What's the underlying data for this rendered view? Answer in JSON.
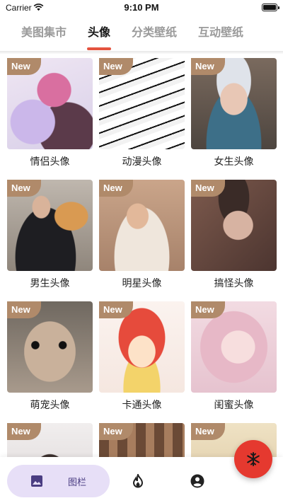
{
  "status": {
    "carrier": "Carrier",
    "time": "9:10 PM"
  },
  "tabs": [
    {
      "label": "美图集市",
      "active": false
    },
    {
      "label": "头像",
      "active": true
    },
    {
      "label": "分类壁纸",
      "active": false
    },
    {
      "label": "互动壁纸",
      "active": false
    }
  ],
  "accent_color": "#e4533f",
  "badge_color": "#b08a6a",
  "cards": [
    {
      "badge": "New",
      "caption": "情侣头像"
    },
    {
      "badge": "New",
      "caption": "动漫头像"
    },
    {
      "badge": "New",
      "caption": "女生头像"
    },
    {
      "badge": "New",
      "caption": "男生头像"
    },
    {
      "badge": "New",
      "caption": "明星头像"
    },
    {
      "badge": "New",
      "caption": "搞怪头像"
    },
    {
      "badge": "New",
      "caption": "萌宠头像"
    },
    {
      "badge": "New",
      "caption": "卡通头像"
    },
    {
      "badge": "New",
      "caption": "闺蜜头像"
    },
    {
      "badge": "New",
      "caption": ""
    },
    {
      "badge": "New",
      "caption": ""
    },
    {
      "badge": "New",
      "caption": ""
    }
  ],
  "bottom_nav": {
    "items": [
      {
        "icon": "image-icon",
        "label": "图栏",
        "active": true
      },
      {
        "icon": "fire-icon",
        "label": ""
      },
      {
        "icon": "user-circle-icon",
        "label": ""
      }
    ]
  },
  "fab": {
    "icon": "snowflake-icon",
    "color": "#e5392f"
  }
}
